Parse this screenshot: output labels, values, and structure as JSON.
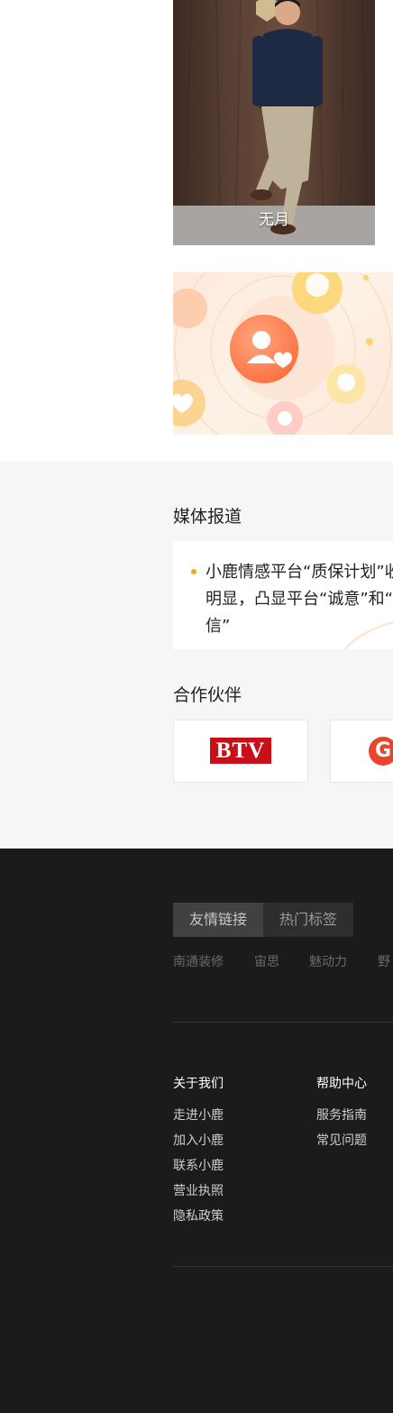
{
  "profile": {
    "name": "无月"
  },
  "media": {
    "title": "媒体报道",
    "news_lines": [
      "小鹿情感平台“质保计划”收",
      "明显，凸显平台“诚意”和“",
      "信”"
    ]
  },
  "partners": {
    "title": "合作伙伴",
    "items": [
      "BTV",
      "G"
    ]
  },
  "footer": {
    "tabs": [
      "友情链接",
      "热门标签"
    ],
    "links": [
      "南通装修",
      "宙思",
      "魅动力",
      "野"
    ],
    "columns": [
      {
        "title": "关于我们",
        "items": [
          "走进小鹿",
          "加入小鹿",
          "联系小鹿",
          "营业执照",
          "隐私政策"
        ]
      },
      {
        "title": "帮助中心",
        "items": [
          "服务指南",
          "常见问题"
        ]
      }
    ]
  },
  "colors": {
    "accent_orange": "#f5a623",
    "footer_bg": "#1b1b1b",
    "section_gray": "#f6f6f6",
    "btv_red": "#c8101a"
  }
}
